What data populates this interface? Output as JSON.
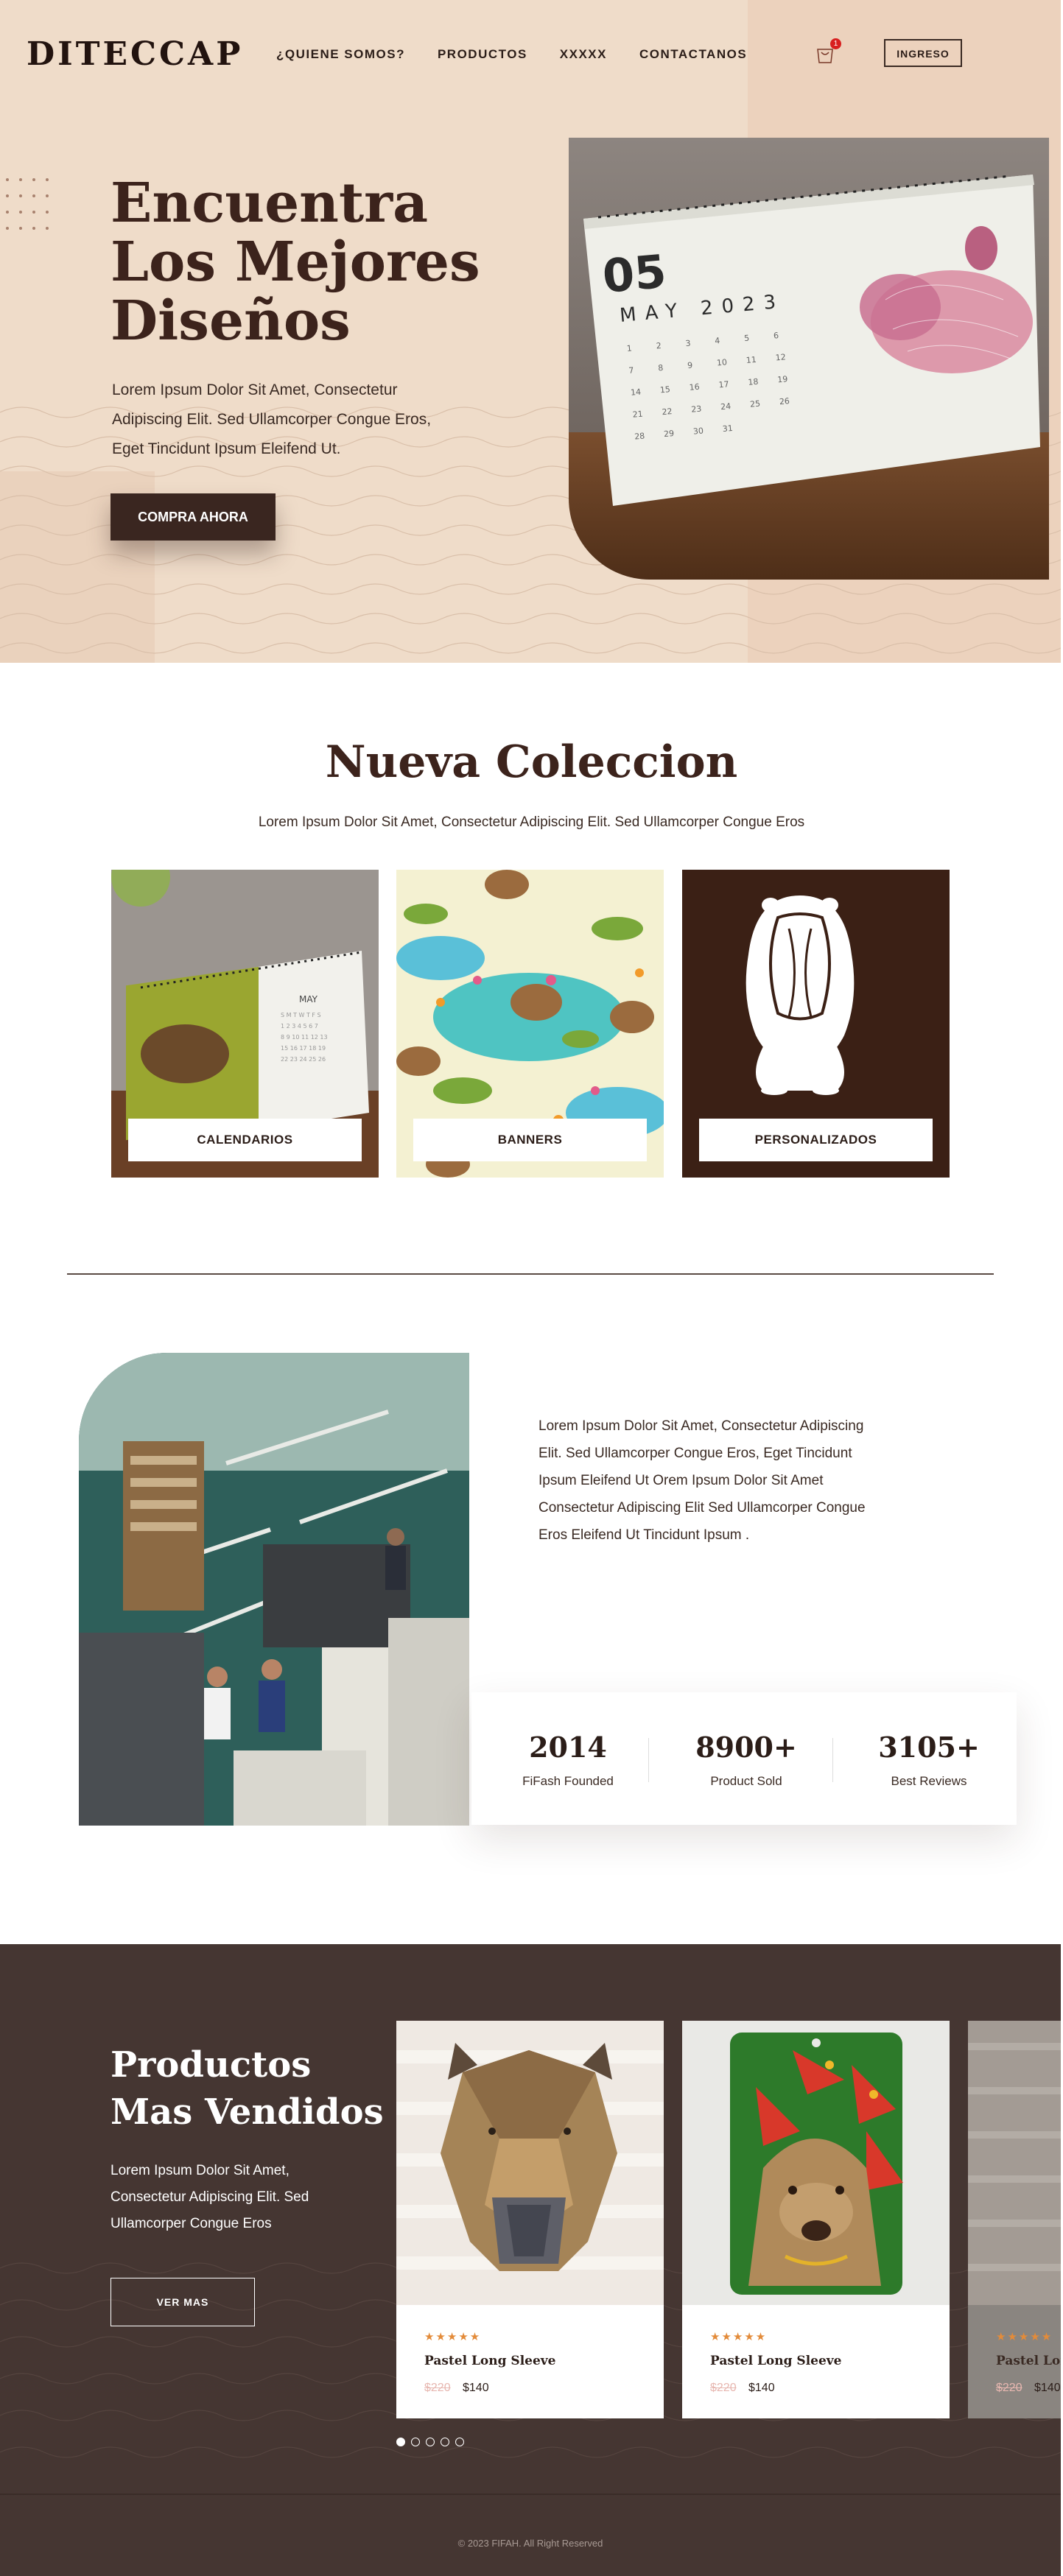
{
  "header": {
    "logo": "DITECCAP",
    "nav": [
      "¿QUIENE SOMOS?",
      "PRODUCTOS",
      "XXXXX",
      "CONTACTANOS"
    ],
    "cart_count": "1",
    "login_label": "INGRESO"
  },
  "hero": {
    "title": "Encuentra Los Mejores Diseños",
    "text": "Lorem Ipsum Dolor Sit Amet, Consectetur Adipiscing Elit. Sed Ullamcorper Congue Eros, Eget Tincidunt Ipsum Eleifend Ut.",
    "button": "COMPRA AHORA",
    "calendar": {
      "day": "05",
      "month_year": "MAY 2023"
    }
  },
  "collection": {
    "title": "Nueva Coleccion",
    "subtitle": "Lorem Ipsum Dolor Sit Amet, Consectetur Adipiscing Elit. Sed Ullamcorper Congue Eros",
    "cards": [
      {
        "label": "CALENDARIOS"
      },
      {
        "label": "BANNERS"
      },
      {
        "label": "PERSONALIZADOS"
      }
    ]
  },
  "about": {
    "text": "Lorem Ipsum Dolor Sit Amet, Consectetur Adipiscing Elit. Sed Ullamcorper Congue Eros, Eget Tincidunt Ipsum Eleifend Ut Orem Ipsum Dolor Sit Amet Consectetur Adipiscing Elit Sed Ullamcorper Congue Eros Eleifend Ut Tincidunt Ipsum .",
    "stats": [
      {
        "number": "2014",
        "label": "FiFash Founded"
      },
      {
        "number": "8900+",
        "label": "Product Sold"
      },
      {
        "number": "3105+",
        "label": "Best Reviews"
      }
    ]
  },
  "best": {
    "title": "Productos Mas Vendidos",
    "text": "Lorem Ipsum Dolor Sit Amet, Consectetur Adipiscing Elit. Sed Ullamcorper Congue Eros",
    "button": "VER MAS",
    "products": [
      {
        "stars": "★★★★★",
        "name": "Pastel Long Sleeve",
        "old_price": "$220",
        "price": "$140"
      },
      {
        "stars": "★★★★★",
        "name": "Pastel Long Sleeve",
        "old_price": "$220",
        "price": "$140"
      },
      {
        "stars": "★★★★★",
        "name": "Pastel Long Sleeve",
        "old_price": "$220",
        "price": "$140"
      }
    ],
    "carousel_active": 1,
    "carousel_total": 5
  },
  "footer": {
    "text": "© 2023 FIFAH. All Right Reserved"
  },
  "colors": {
    "dark_brown": "#3a2620",
    "hero_bg": "#efdcc9",
    "section_dark": "#453632",
    "star": "#e38b3a"
  }
}
